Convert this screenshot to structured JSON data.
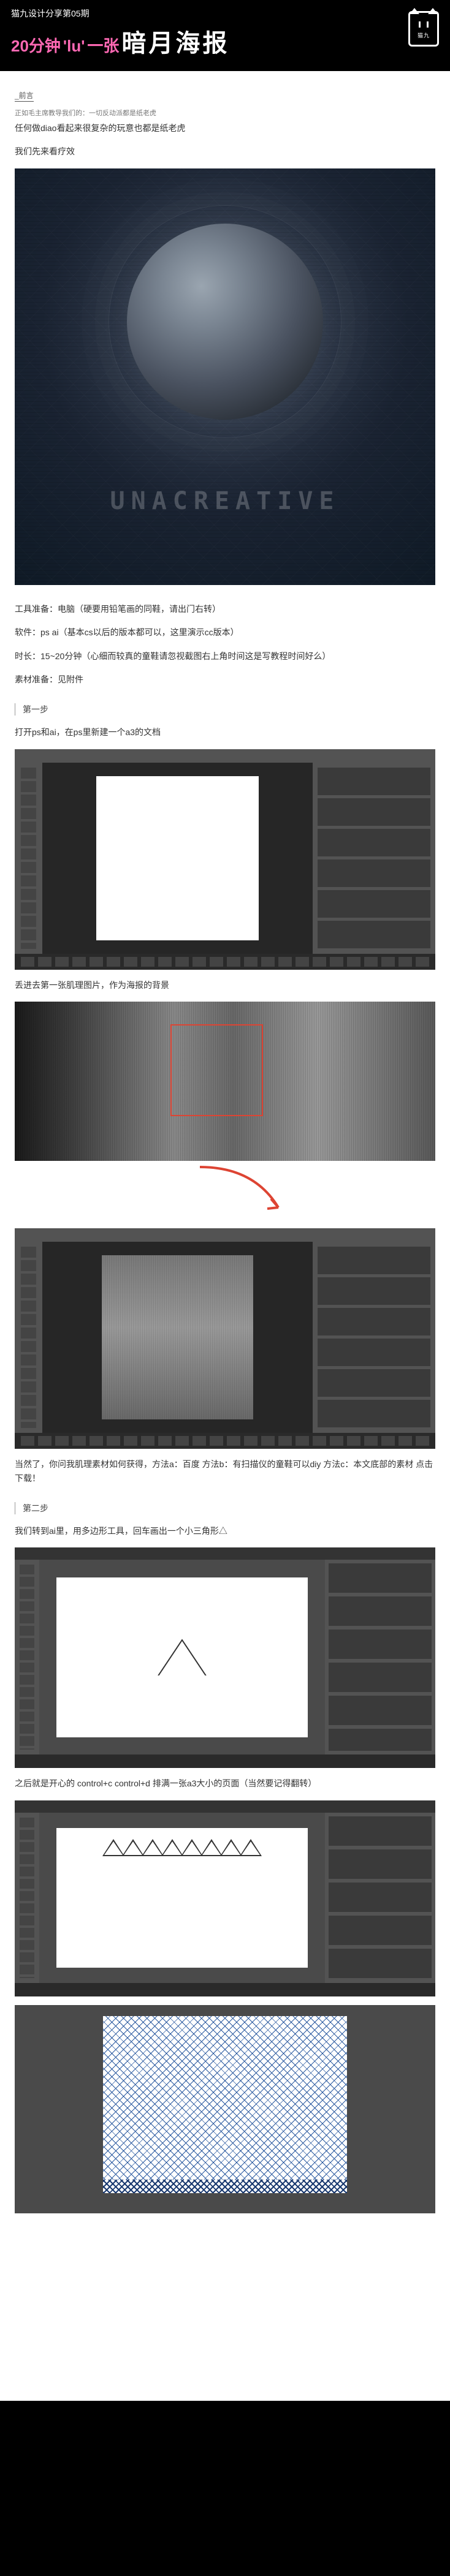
{
  "header": {
    "issue": "猫九设计分享第05期",
    "time_prefix": "20分钟",
    "lu_char": "'lu'",
    "one_sheet": "一张",
    "main_title": "暗月海报",
    "logo_label": "猫九"
  },
  "foreword": {
    "label": "_前言",
    "quote": "正如毛主席教导我们的：一切反动派都是纸老虎",
    "line1": "任何做diao看起来很复杂的玩意也都是纸老虎",
    "line2": "我们先来看疗效"
  },
  "poster": {
    "text": "UNACREATIVE"
  },
  "prep": {
    "tools": "工具准备：电脑（硬要用铅笔画的同鞋，请出门右转）",
    "software": "软件：ps ai（基本cs以后的版本都可以，这里演示cc版本）",
    "time": "时长：15~20分钟（心细而较真的童鞋请忽视截图右上角时间这是写教程时间好么）",
    "assets": "素材准备：见附件"
  },
  "step1": {
    "label": "第一步",
    "text1": "打开ps和ai，在ps里新建一个a3的文档",
    "text2": "丢进去第一张肌理图片，作为海报的背景",
    "text3": "当然了，你问我肌理素材如何获得，方法a：百度 方法b：有扫描仪的童鞋可以diy 方法c：本文底部的素材 点击下载！"
  },
  "step2": {
    "label": "第二步",
    "text1": "我们转到ai里，用多边形工具，回车画出一个小三角形△",
    "text2": "之后就是开心的   control+c control+d 排满一张a3大小的页面（当然要记得翻转）"
  }
}
